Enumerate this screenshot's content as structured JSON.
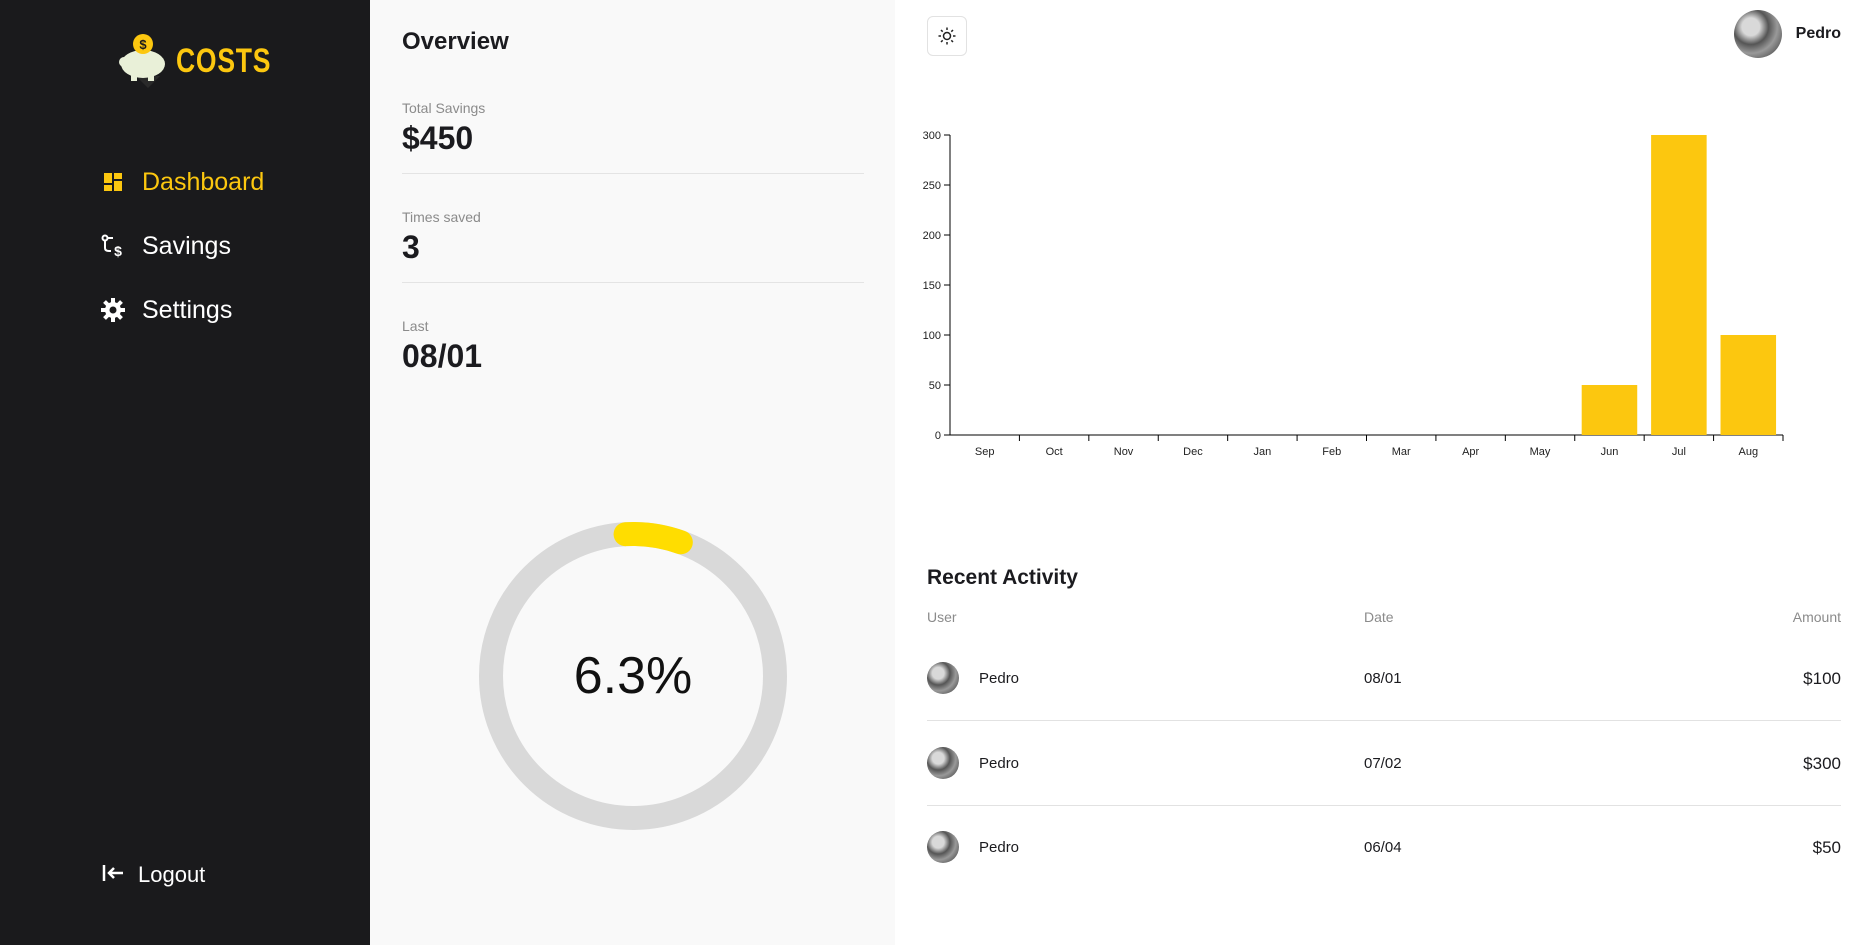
{
  "sidebar": {
    "logo_text": "COSTS",
    "items": [
      {
        "label": "Dashboard",
        "icon": "dashboard-icon",
        "active": true
      },
      {
        "label": "Savings",
        "icon": "savings-icon",
        "active": false
      },
      {
        "label": "Settings",
        "icon": "gear-icon",
        "active": false
      }
    ],
    "logout_label": "Logout"
  },
  "overview": {
    "title": "Overview",
    "stats": [
      {
        "label": "Total Savings",
        "value": "$450"
      },
      {
        "label": "Times saved",
        "value": "3"
      },
      {
        "label": "Last",
        "value": "08/01"
      }
    ],
    "progress_text": "6.3%",
    "progress_fraction": 0.063
  },
  "header": {
    "user_name": "Pedro",
    "theme_icon": "sun-icon"
  },
  "colors": {
    "accent": "#fcc70f",
    "sidebar_bg": "#1a1a1c",
    "ring_track": "#d9d9d9",
    "ring_fill": "#ffdd00"
  },
  "chart_data": {
    "type": "bar",
    "categories": [
      "Sep",
      "Oct",
      "Nov",
      "Dec",
      "Jan",
      "Feb",
      "Mar",
      "Apr",
      "May",
      "Jun",
      "Jul",
      "Aug"
    ],
    "values": [
      0,
      0,
      0,
      0,
      0,
      0,
      0,
      0,
      0,
      50,
      300,
      100
    ],
    "ylim": [
      0,
      300
    ],
    "yticks": [
      0,
      50,
      100,
      150,
      200,
      250,
      300
    ],
    "grid": false,
    "bar_color": "#fcc70f"
  },
  "recent_activity": {
    "title": "Recent Activity",
    "columns": [
      "User",
      "Date",
      "Amount"
    ],
    "rows": [
      {
        "user": "Pedro",
        "date": "08/01",
        "amount": "$100"
      },
      {
        "user": "Pedro",
        "date": "07/02",
        "amount": "$300"
      },
      {
        "user": "Pedro",
        "date": "06/04",
        "amount": "$50"
      }
    ]
  }
}
